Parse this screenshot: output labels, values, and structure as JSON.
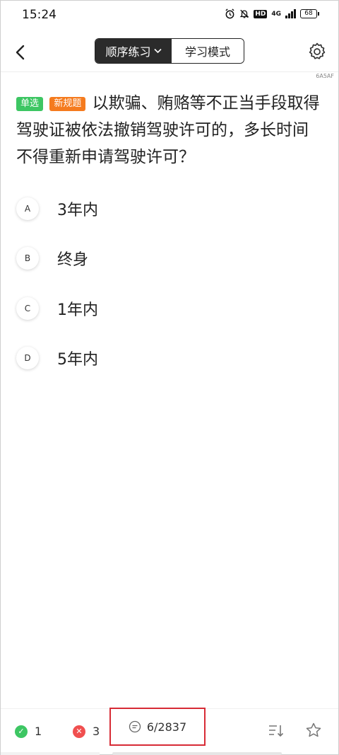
{
  "status_bar": {
    "time": "15:24",
    "network": "4G",
    "battery": "68"
  },
  "nav": {
    "mode_active": "顺序练习",
    "mode_inactive": "学习模式"
  },
  "question_id": "6A5AF",
  "question": {
    "tags": [
      "单选",
      "新规题"
    ],
    "text": "以欺骗、贿赂等不正当手段取得驾驶证被依法撤销驾驶许可的，多长时间不得重新申请驾驶许可？"
  },
  "options": [
    {
      "letter": "A",
      "text": "3年内"
    },
    {
      "letter": "B",
      "text": "终身"
    },
    {
      "letter": "C",
      "text": "1年内"
    },
    {
      "letter": "D",
      "text": "5年内"
    }
  ],
  "bottom_bar": {
    "correct_count": "1",
    "wrong_count": "3",
    "progress": "6/2837"
  },
  "colors": {
    "accent_green": "#3dc663",
    "tag_orange": "#f57b1e",
    "wrong_red": "#f04f4f",
    "highlight_box": "#d72b35"
  }
}
